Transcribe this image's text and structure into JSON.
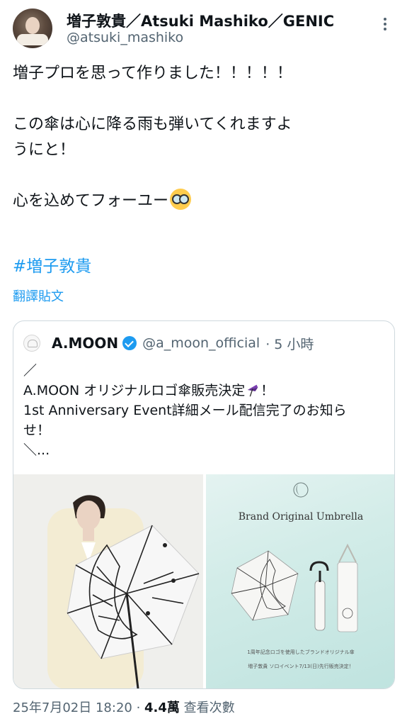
{
  "author": {
    "display_name": "増子敦貴／Atsuki Mashiko／GENIC",
    "handle": "@atsuki_mashiko"
  },
  "icons": [
    "more-icon",
    "verified-icon",
    "umbrella-emoji",
    "nerd-face-emoji"
  ],
  "tweet": {
    "lines": [
      "増子プロを思って作りました！！！！！",
      "",
      "この傘は心に降る雨も弾いてくれますよ",
      "うにと！",
      "",
      "心を込めてフォーユー"
    ],
    "hashtag": "#増子敦貴",
    "translate_label": "翻譯貼文"
  },
  "quote": {
    "name": "A.MOON",
    "handle": "@a_moon_official",
    "time": "· 5 小時",
    "lines": [
      "／",
      "A.MOON オリジナルロゴ傘販売決定",
      "1st Anniversary Event詳細メール配信完了のお知ら",
      "せ！",
      "＼..."
    ],
    "line2_suffix": "！",
    "media": {
      "right_title": "Brand Original Umbrella",
      "right_caption_1": "1周年記念ロゴを使用したブランドオリジナル傘",
      "right_caption_2": "増子敦貴 ソロイベント7/13(日)先行販売決定！"
    }
  },
  "footer": {
    "timestamp": "25年7月02日 18:20 · ",
    "views_count": "4.4萬",
    "views_label": " 查看次數"
  },
  "colors": {
    "link": "#1d9bf0",
    "secondary_text": "#536471",
    "border": "#cfd9de"
  }
}
